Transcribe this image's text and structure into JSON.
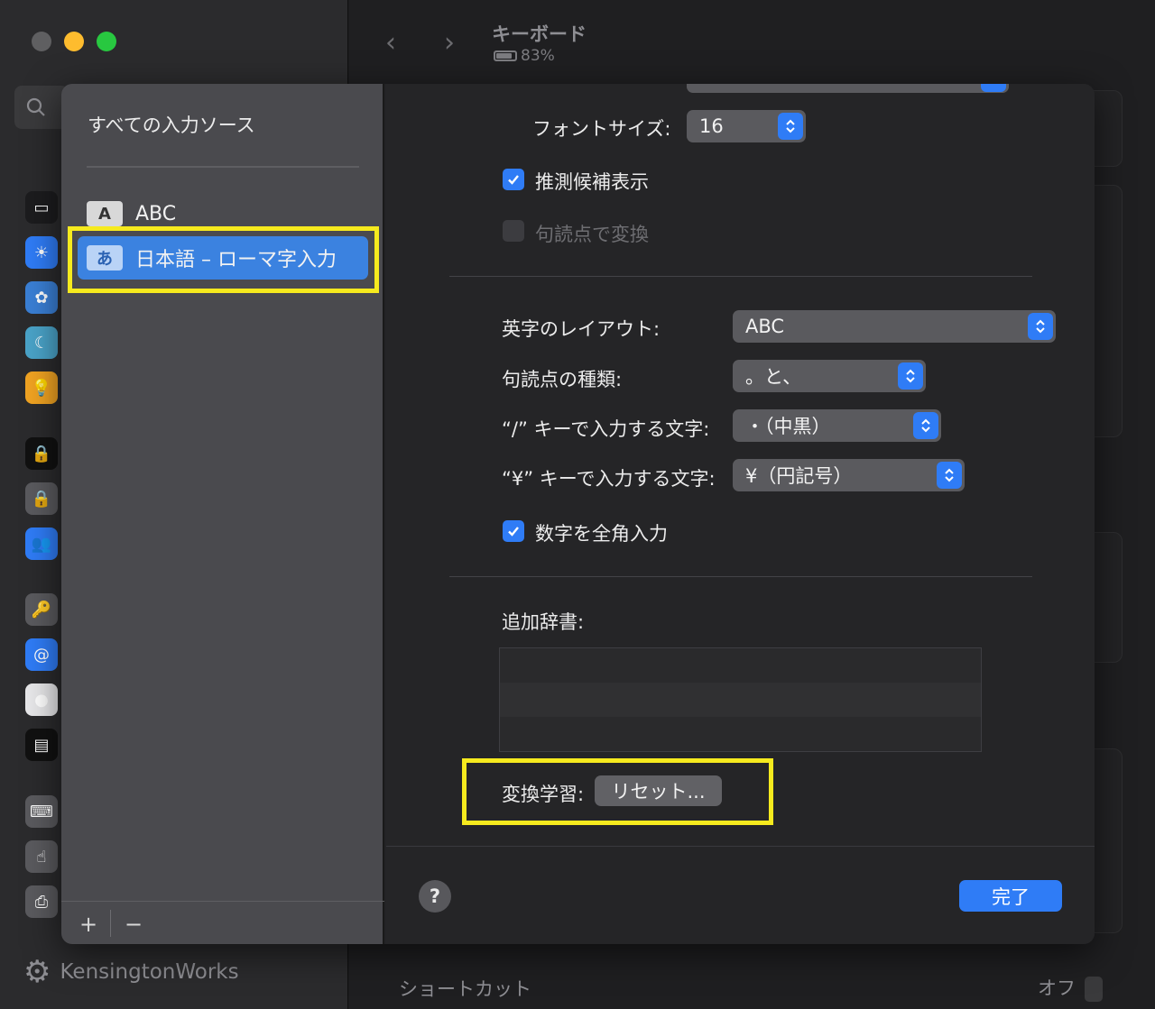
{
  "window": {
    "title": "キーボード",
    "battery_text": "83%",
    "footer_brand": "KensingtonWorks",
    "bottom_row": {
      "label": "ショートカット",
      "value": "オフ"
    }
  },
  "sources": {
    "title": "すべての入力ソース",
    "items": [
      {
        "badge": "A",
        "label": "ABC"
      },
      {
        "badge": "あ",
        "label": "日本語 – ローマ字入力"
      }
    ],
    "add_label": "+",
    "remove_label": "−"
  },
  "options": {
    "font_size_label": "フォントサイズ:",
    "font_size_value": "16",
    "predictive_label": "推測候補表示",
    "punct_convert_label": "句読点で変換",
    "layout_label": "英字のレイアウト:",
    "layout_value": "ABC",
    "punct_type_label": "句読点の種類:",
    "punct_type_value": "。と、",
    "slash_label": "“/” キーで入力する文字:",
    "slash_value": "・（中黒）",
    "yen_label": "“¥” キーで入力する文字:",
    "yen_value": "¥（円記号）",
    "fullwidth_label": "数字を全角入力",
    "dict_label": "追加辞書:",
    "learning_label": "変換学習:",
    "reset_label": "リセット...",
    "help_label": "?",
    "done_label": "完了"
  },
  "state": {
    "predictive_checked": true,
    "punct_convert_checked": false,
    "fullwidth_checked": true
  },
  "colors": {
    "accent": "#2f7cf6",
    "highlight": "#f6ea1e",
    "selected_row": "#3b82e0"
  }
}
